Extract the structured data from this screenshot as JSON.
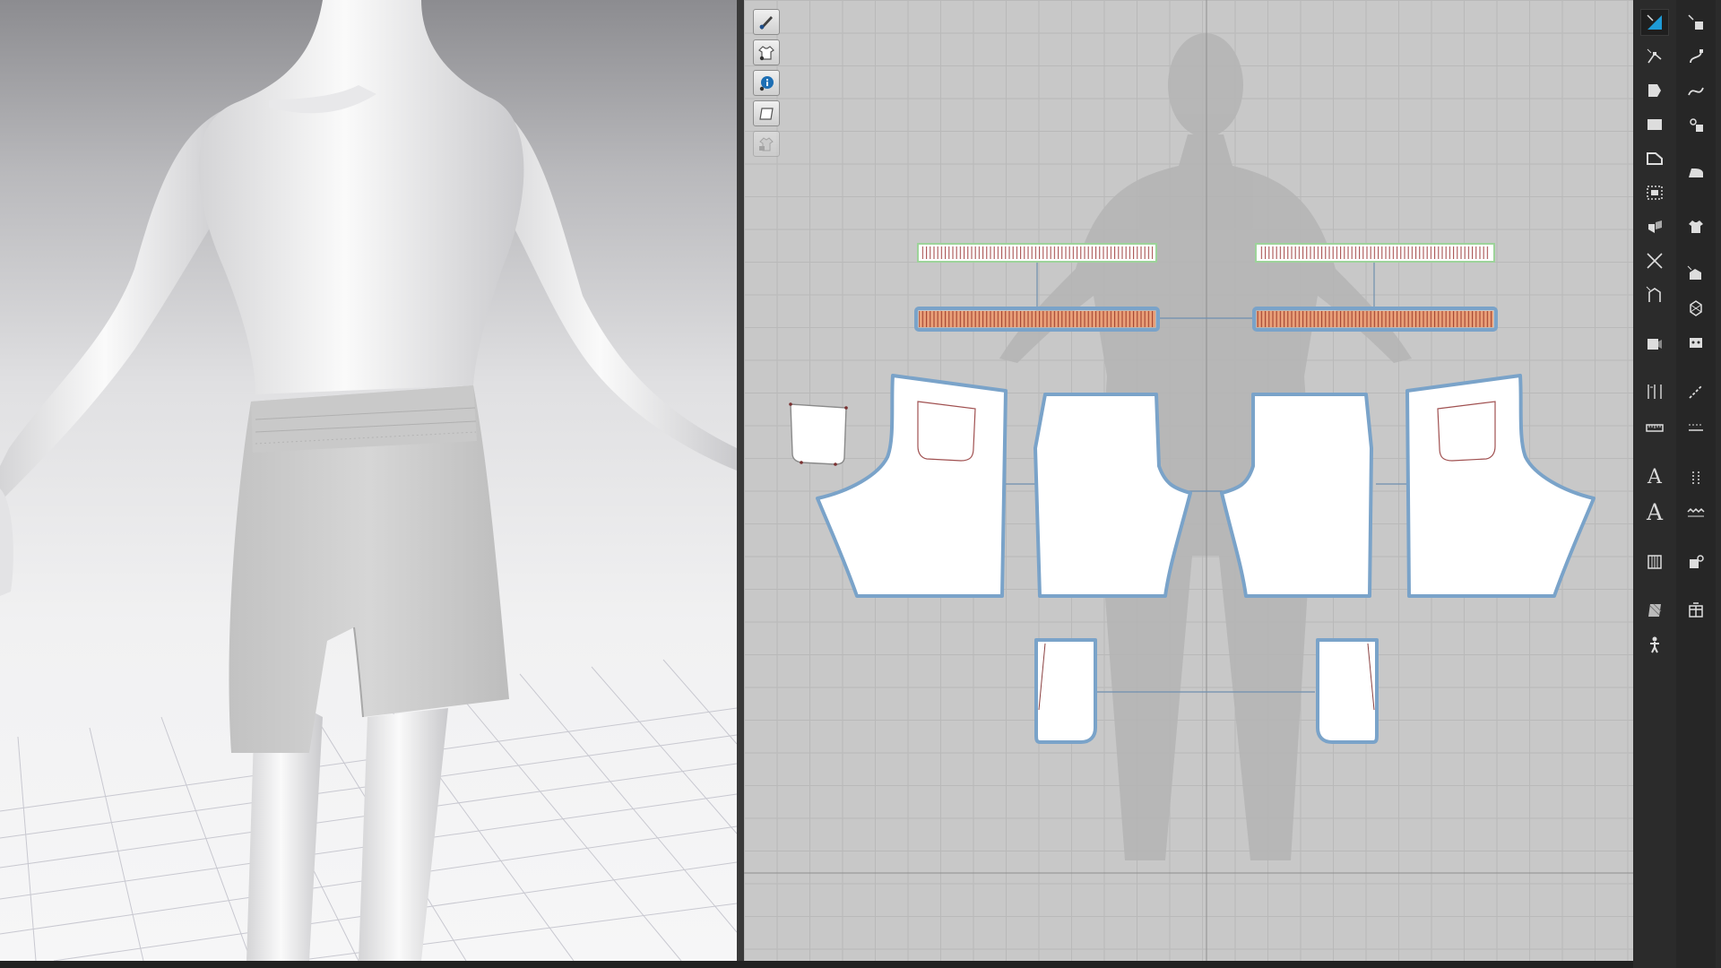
{
  "app": {
    "accent_color": "#1e9bd7",
    "piece_outline_color": "#7aa3c9",
    "selected_strip_color": "#e07b50",
    "binding_strip_color": "#9dd39a"
  },
  "toolbar_2d": {
    "items": [
      {
        "icon": "show-avatar-icon",
        "disabled": false
      },
      {
        "icon": "show-garment-icon",
        "disabled": false
      },
      {
        "icon": "info-icon",
        "disabled": false
      },
      {
        "icon": "sheet-icon",
        "disabled": false
      },
      {
        "icon": "lock-garment-icon",
        "disabled": true
      }
    ]
  },
  "right_toolbar": {
    "left_column": [
      "select-pattern-icon",
      "edit-pattern-icon",
      "transform-pattern-icon",
      "rectangle-icon",
      "polygon-icon",
      "internal-rectangle-icon",
      "fold-arrange-icon",
      "cut-icon",
      "dart-icon",
      "zipper-icon",
      "measure-icon",
      "ruler-icon",
      "text-annotation-icon",
      "text-icon",
      "elastic-icon",
      "fabric-icon",
      "avatar-pose-icon"
    ],
    "right_column": [
      "segment-sewing-icon",
      "free-sewing-icon",
      "curve-icon",
      "tack-icon",
      "steam-iron-icon",
      "garment-icon",
      "puckering-icon",
      "button-icon",
      "buttonhole-icon",
      "topstitch-icon",
      "stitch-length-icon",
      "grading-icon",
      "zigzag-icon",
      "material-icon",
      "trim-icon"
    ],
    "active_left": 0,
    "glyph_A": "A"
  }
}
